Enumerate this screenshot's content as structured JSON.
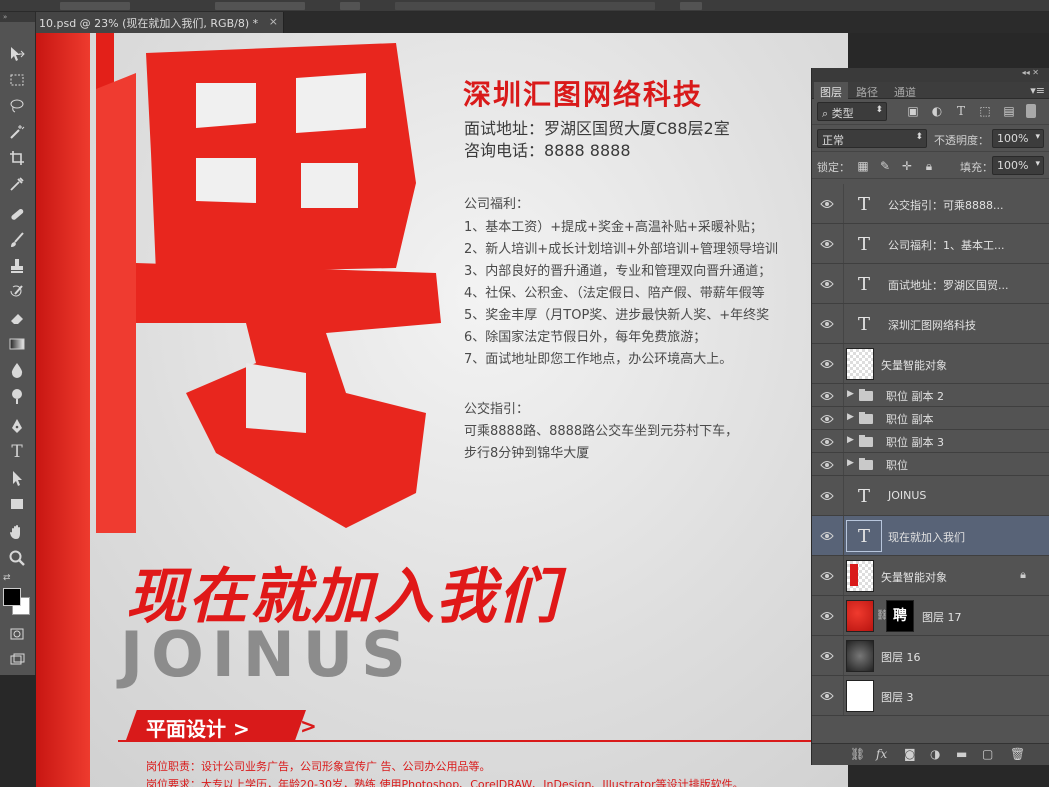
{
  "document": {
    "tab_title": "10.psd @ 23% (现在就加入我们, RGB/8) *",
    "close_glyph": "×"
  },
  "poster": {
    "big_char": "聘",
    "company": "深圳汇图网络科技",
    "address": "面试地址：罗湖区国贸大厦C88层2室",
    "phone": "咨询电话：8888 8888",
    "benefits_title": "公司福利：",
    "benefits": [
      "1、基本工资）+提成+奖金+高温补贴+采暖补贴；",
      "2、新人培训+成长计划培训+外部培训+管理领导培训",
      "3、内部良好的晋升通道，专业和管理双向晋升通道；",
      "4、社保、公积金、（法定假日、陪产假、带薪年假等",
      "5、奖金丰厚（月TOP奖、进步最快新人奖、+年终奖",
      "6、除国家法定节假日外，每年免费旅游；",
      "7、面试地址即您工作地点，办公环境高大上。"
    ],
    "transit_title": "公交指引：",
    "transit": [
      "可乘8888路、8888路公交车坐到元芬村下车，",
      "步行8分钟到锦华大厦"
    ],
    "join_cn": "现在就加入我们",
    "join_en": "JOINUS",
    "position_label": "平面设计 >",
    "position_arrow": ">",
    "duty_1": "岗位职责：设计公司业务广告，公司形象宣传广 告、公司办公用品等。",
    "duty_2": "岗位要求：大专以上学历，年龄20-30岁，熟练 使用Photoshop、CorelDRAW、InDesign、Illustrator等设计排版软件。",
    "colors": {
      "red": "#d91a1a",
      "gray": "#8c8c8c"
    }
  },
  "layers_panel": {
    "tabs": [
      "图层",
      "路径",
      "通道"
    ],
    "filter_kind": "类型",
    "blend_mode": "正常",
    "opacity_label": "不透明度：",
    "opacity_value": "100%",
    "lock_label": "锁定：",
    "fill_label": "填充：",
    "fill_value": "100%",
    "layers": [
      {
        "name": "公交指引：可乘8888...",
        "type": "text"
      },
      {
        "name": "公司福利：1、基本工...",
        "type": "text"
      },
      {
        "name": "面试地址：罗湖区国贸...",
        "type": "text"
      },
      {
        "name": "深圳汇图网络科技",
        "type": "text"
      },
      {
        "name": "矢量智能对象",
        "type": "smart"
      },
      {
        "name": "职位 副本 2",
        "type": "group"
      },
      {
        "name": "职位 副本",
        "type": "group"
      },
      {
        "name": "职位 副本 3",
        "type": "group"
      },
      {
        "name": "职位",
        "type": "group"
      },
      {
        "name": "JOINUS",
        "type": "text"
      },
      {
        "name": "现在就加入我们",
        "type": "text",
        "selected": true
      },
      {
        "name": "矢量智能对象",
        "type": "smart-locked"
      },
      {
        "name": "图层 17",
        "type": "masked"
      },
      {
        "name": "图层 16",
        "type": "pixel"
      },
      {
        "name": "图层 3",
        "type": "pixel"
      }
    ],
    "text_thumb_glyph": "T",
    "mask_char": "聘"
  }
}
